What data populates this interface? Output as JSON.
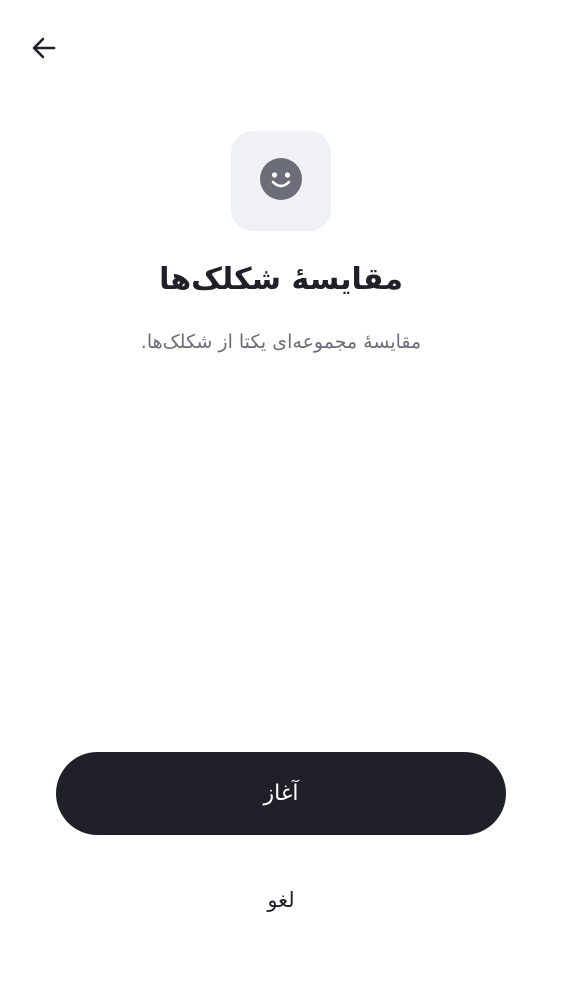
{
  "header": {
    "back_icon": "arrow-left-icon"
  },
  "hero": {
    "icon": "smiley-face-icon",
    "tile_color": "#f0f1f5",
    "face_color": "#6b6e78"
  },
  "content": {
    "title": "مقایسهٔ شکلک‌ها",
    "subtitle": "مقایسهٔ مجموعه‌ای یکتا از شکلک‌ها."
  },
  "actions": {
    "start_label": "آغاز",
    "cancel_label": "لغو",
    "primary_color": "#1f2028"
  }
}
